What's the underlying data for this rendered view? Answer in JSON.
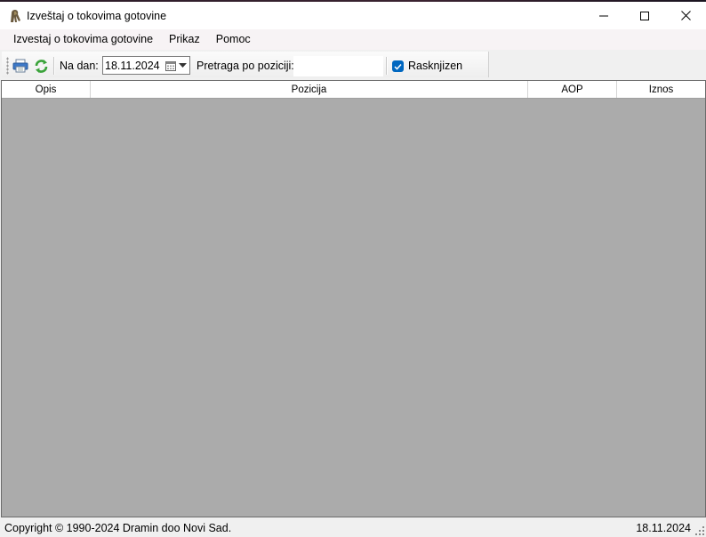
{
  "window": {
    "title": "Izveštaj o tokovima gotovine",
    "icon": "dramin-app-icon"
  },
  "window_controls": {
    "minimize_icon": "minimize-icon",
    "maximize_icon": "maximize-icon",
    "close_icon": "close-icon"
  },
  "menu": {
    "items": [
      {
        "label": "Izvestaj o tokovima gotovine"
      },
      {
        "label": "Prikaz"
      },
      {
        "label": "Pomoc"
      }
    ]
  },
  "toolbar": {
    "print_icon": "printer-icon",
    "refresh_icon": "refresh-icon",
    "date_label": "Na dan:",
    "date_value": "18.11.2024",
    "search_label": "Pretraga po poziciji:",
    "search_value": "",
    "checkbox_label": "Rasknjizen",
    "checkbox_checked": true
  },
  "grid": {
    "columns": [
      "Opis",
      "Pozicija",
      "AOP",
      "Iznos"
    ],
    "rows": []
  },
  "status": {
    "copyright": "Copyright © 1990-2024 Dramin doo Novi Sad.",
    "date": "18.11.2024"
  },
  "colors": {
    "accent": "#0067c0",
    "grid_background": "#ababab",
    "refresh_green": "#3aa33a",
    "printer_blue": "#3c78c8"
  }
}
